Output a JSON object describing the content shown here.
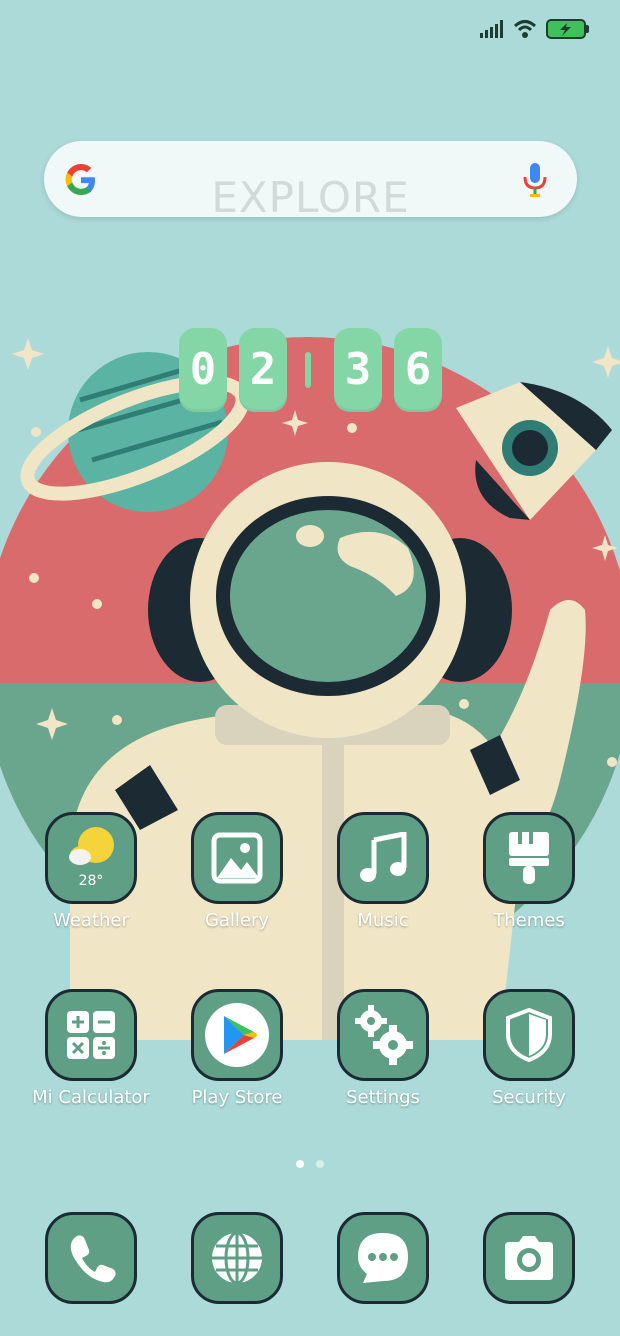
{
  "status_bar": {
    "signal_icon": "signal-bars-icon",
    "wifi_icon": "wifi-icon",
    "battery_icon": "battery-charging-icon"
  },
  "search": {
    "logo": "google-g-icon",
    "watermark": "EXPLORE",
    "mic_icon": "microphone-icon"
  },
  "clock": {
    "digits": [
      "0",
      "2",
      "3",
      "6"
    ]
  },
  "apps_row1": [
    {
      "label": "Weather",
      "icon": "sun-cloud-icon",
      "badge": "28°"
    },
    {
      "label": "Gallery",
      "icon": "image-icon"
    },
    {
      "label": "Music",
      "icon": "music-note-icon"
    },
    {
      "label": "Themes",
      "icon": "paintbrush-icon"
    }
  ],
  "apps_row2": [
    {
      "label": "Mi Calculator",
      "icon": "calculator-icon"
    },
    {
      "label": "Play Store",
      "icon": "play-store-icon"
    },
    {
      "label": "Settings",
      "icon": "gears-icon"
    },
    {
      "label": "Security",
      "icon": "shield-icon"
    }
  ],
  "page_indicator": {
    "pages": 2,
    "active": 0
  },
  "dock": [
    {
      "icon": "phone-icon"
    },
    {
      "icon": "globe-icon"
    },
    {
      "icon": "message-icon"
    },
    {
      "icon": "camera-icon"
    }
  ],
  "colors": {
    "background": "#acdad8",
    "tile": "#5f9f86",
    "clock": "#85d6a7",
    "red_band": "#d96b6c",
    "green_band": "#6aa58d"
  }
}
